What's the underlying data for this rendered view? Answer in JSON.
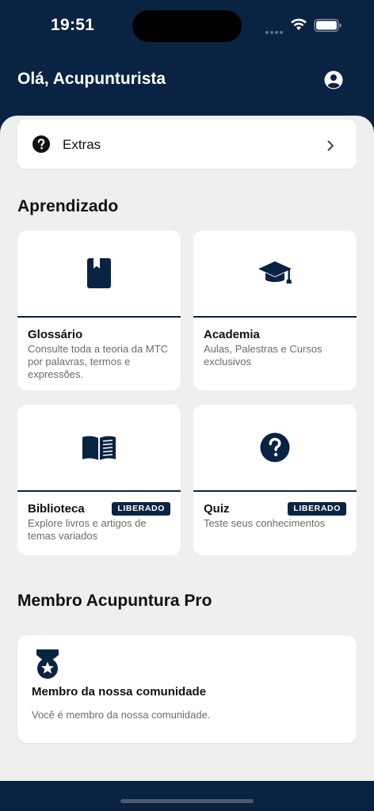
{
  "status_bar": {
    "time": "19:51"
  },
  "header": {
    "greeting": "Olá, Acupunturista",
    "profile_icon": "account-circle-icon"
  },
  "extras": {
    "label": "Extras",
    "icon": "help-circle-icon"
  },
  "learning": {
    "title": "Aprendizado",
    "cards": [
      {
        "title": "Glossário",
        "description": "Consulte toda a teoria da MTC por palavras, termos e expressões.",
        "icon": "book-icon",
        "badge": ""
      },
      {
        "title": "Academia",
        "description": "Aulas, Palestras e Cursos exclusivos",
        "icon": "graduation-cap-icon",
        "badge": ""
      },
      {
        "title": "Biblioteca",
        "description": "Explore livros e artigos de temas variados",
        "icon": "open-book-icon",
        "badge": "LIBERADO"
      },
      {
        "title": "Quiz",
        "description": "Teste seus conhecimentos",
        "icon": "question-circle-icon",
        "badge": "LIBERADO"
      }
    ]
  },
  "membership": {
    "title": "Membro Acupuntura Pro",
    "card_title": "Membro da nossa comunidade",
    "card_description": "Você é membro da nossa comunidade.",
    "icon": "medal-icon"
  },
  "colors": {
    "primary": "#0a2342",
    "background": "#efefef",
    "card": "#ffffff",
    "muted_text": "#6b6b6b"
  }
}
